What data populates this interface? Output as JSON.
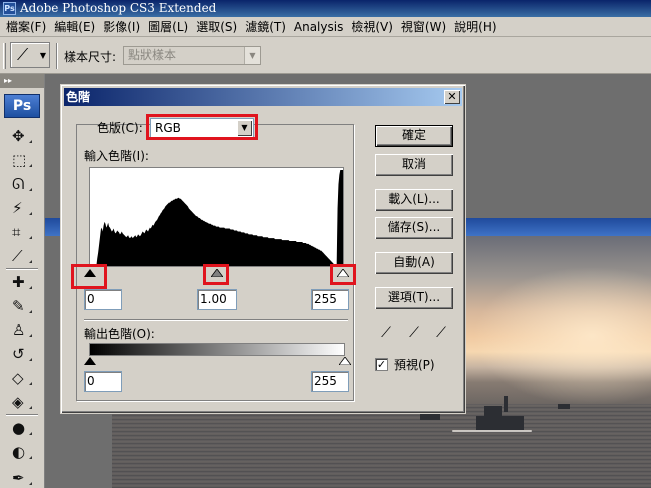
{
  "app": {
    "badge": "Ps",
    "title": "Adobe Photoshop CS3 Extended"
  },
  "menu": [
    "檔案(F)",
    "編輯(E)",
    "影像(I)",
    "圖層(L)",
    "選取(S)",
    "濾鏡(T)",
    "Analysis",
    "檢視(V)",
    "視窗(W)",
    "說明(H)"
  ],
  "options_bar": {
    "sample_size_label": "樣本尺寸:",
    "sample_size_value": "點狀樣本"
  },
  "toolbox": {
    "logo": "Ps",
    "tools": [
      {
        "name": "move-tool-icon",
        "glyph": "✥"
      },
      {
        "name": "marquee-tool-icon",
        "glyph": "⬚"
      },
      {
        "name": "lasso-tool-icon",
        "glyph": "ᘏ"
      },
      {
        "name": "magic-wand-tool-icon",
        "glyph": "⚡"
      },
      {
        "name": "crop-tool-icon",
        "glyph": "⌗"
      },
      {
        "name": "eyedropper-tool-icon",
        "glyph": "⟋"
      },
      {
        "name": "healing-brush-tool-icon",
        "glyph": "✚"
      },
      {
        "name": "brush-tool-icon",
        "glyph": "✎"
      },
      {
        "name": "clone-stamp-tool-icon",
        "glyph": "♙"
      },
      {
        "name": "history-brush-tool-icon",
        "glyph": "↺"
      },
      {
        "name": "eraser-tool-icon",
        "glyph": "◇"
      },
      {
        "name": "paint-bucket-tool-icon",
        "glyph": "◈"
      },
      {
        "name": "blur-tool-icon",
        "glyph": "●"
      },
      {
        "name": "dodge-tool-icon",
        "glyph": "◐"
      },
      {
        "name": "pen-tool-icon",
        "glyph": "✒"
      },
      {
        "name": "type-tool-icon",
        "glyph": "T"
      }
    ]
  },
  "dialog": {
    "title": "色階",
    "close": "✕",
    "channel_label": "色版(C):",
    "channel_value": "RGB",
    "input_levels_label": "輸入色階(I):",
    "input_black": "0",
    "input_gamma": "1.00",
    "input_white": "255",
    "output_levels_label": "輸出色階(O):",
    "output_black": "0",
    "output_white": "255",
    "buttons": {
      "ok": "確定",
      "cancel": "取消",
      "load": "載入(L)...",
      "save": "儲存(S)...",
      "auto": "自動(A)",
      "options": "選項(T)..."
    },
    "preview_label": "預視(P)",
    "preview_checked": true,
    "histogram": [
      0,
      0,
      0,
      0,
      0,
      0,
      0,
      0,
      8,
      14,
      22,
      30,
      38,
      40,
      36,
      42,
      46,
      44,
      40,
      42,
      45,
      41,
      40,
      38,
      36,
      37,
      39,
      36,
      34,
      35,
      37,
      36,
      35,
      33,
      34,
      36,
      34,
      33,
      32,
      31,
      30,
      31,
      32,
      30,
      29,
      30,
      31,
      29,
      30,
      31,
      32,
      30,
      31,
      33,
      32,
      31,
      32,
      34,
      36,
      35,
      34,
      36,
      38,
      37,
      36,
      38,
      40,
      39,
      41,
      43,
      42,
      44,
      46,
      47,
      48,
      50,
      52,
      53,
      55,
      56,
      58,
      59,
      60,
      62,
      63,
      64,
      65,
      66,
      66,
      67,
      68,
      68,
      69,
      69,
      70,
      70,
      70,
      71,
      71,
      70,
      70,
      69,
      68,
      67,
      66,
      65,
      64,
      63,
      62,
      60,
      59,
      58,
      57,
      56,
      55,
      54,
      53,
      52,
      52,
      51,
      50,
      50,
      49,
      48,
      48,
      47,
      47,
      46,
      46,
      45,
      45,
      44,
      44,
      44,
      43,
      43,
      42,
      42,
      42,
      41,
      41,
      41,
      41,
      40,
      40,
      40,
      40,
      40,
      40,
      39,
      39,
      39,
      39,
      39,
      39,
      38,
      38,
      38,
      38,
      37,
      37,
      37,
      37,
      36,
      36,
      36,
      36,
      35,
      35,
      35,
      35,
      34,
      34,
      34,
      34,
      33,
      33,
      33,
      33,
      33,
      32,
      32,
      32,
      32,
      32,
      31,
      31,
      31,
      31,
      31,
      31,
      30,
      30,
      30,
      30,
      30,
      30,
      29,
      29,
      29,
      29,
      29,
      29,
      29,
      28,
      28,
      28,
      28,
      28,
      28,
      28,
      28,
      27,
      27,
      27,
      27,
      27,
      27,
      27,
      27,
      26,
      26,
      26,
      26,
      26,
      26,
      26,
      26,
      25,
      25,
      25,
      25,
      25,
      25,
      25,
      24,
      24,
      24,
      24,
      23,
      23,
      23,
      22,
      22,
      21,
      21,
      20,
      20,
      19,
      19,
      18,
      18,
      17,
      17,
      16,
      16,
      15,
      14,
      13,
      12,
      11,
      10,
      9,
      8,
      7,
      6,
      5,
      4,
      3,
      2,
      1,
      0,
      0,
      60,
      85,
      95,
      100,
      100,
      100,
      100
    ]
  }
}
